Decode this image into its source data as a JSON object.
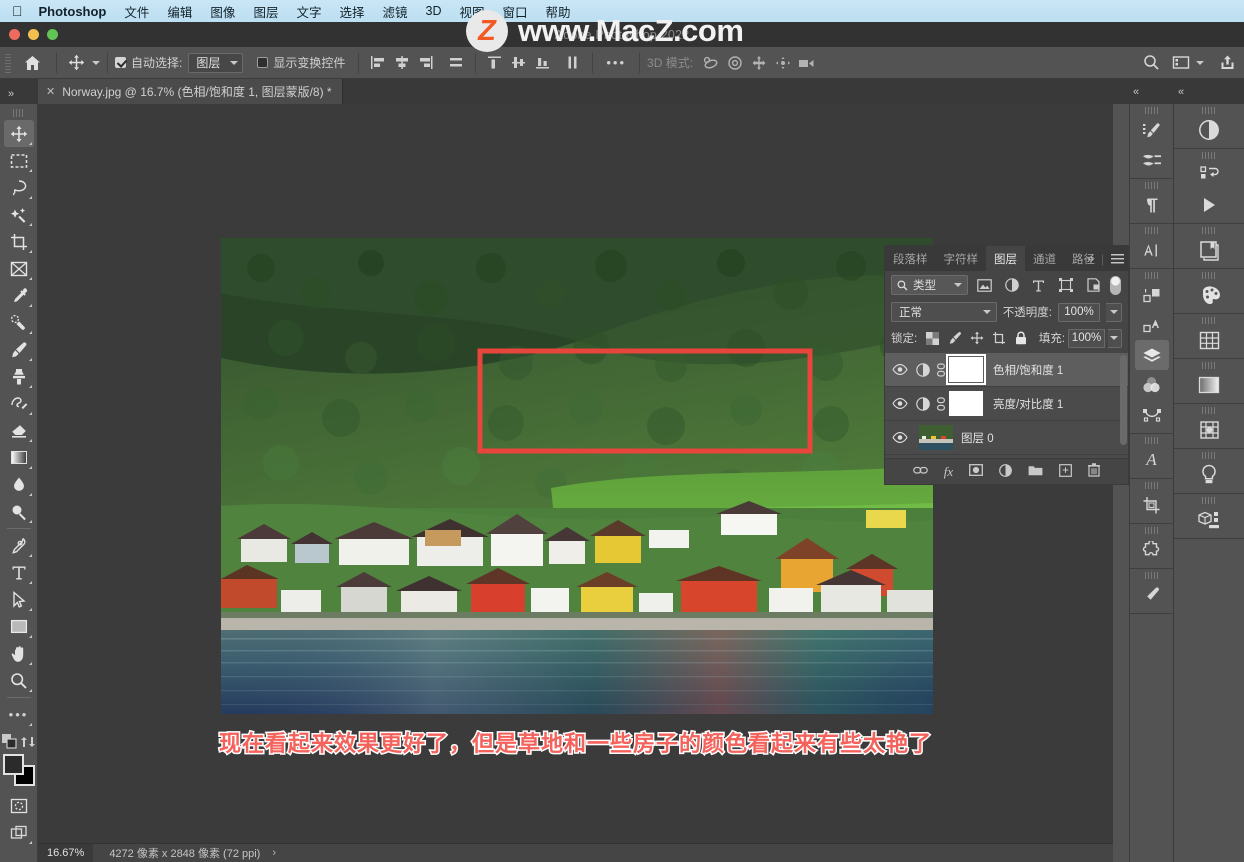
{
  "menubar": {
    "apple_icon": "apple-icon",
    "app_name": "Photoshop",
    "items": [
      "文件",
      "编辑",
      "图像",
      "图层",
      "文字",
      "选择",
      "滤镜",
      "3D",
      "视图",
      "窗口",
      "帮助"
    ]
  },
  "titlebar": {
    "title": "Adobe Photoshop 2022"
  },
  "watermark": {
    "text": "www.MacZ.com",
    "logo_letter": "Z"
  },
  "options_bar": {
    "home_icon": "home-icon",
    "tool_icon": "move-tool-icon",
    "auto_select_checked": true,
    "auto_select_label": "自动选择:",
    "auto_select_value": "图层",
    "show_transform_checked": false,
    "show_transform_label": "显示变换控件",
    "align_icons": [
      "align-left-edges-icon",
      "align-horizontal-centers-icon",
      "align-right-edges-icon",
      "distribute-horizontally-icon"
    ],
    "align_icons2": [
      "align-top-edges-icon",
      "align-vertical-centers-icon",
      "align-bottom-edges-icon",
      "distribute-vertically-icon"
    ],
    "more_label": "•••",
    "mode3d_label": "3D 模式:",
    "mode3d_icons": [
      "orbit-3d-icon",
      "roll-3d-icon",
      "pan-3d-icon",
      "slide-3d-icon",
      "camera-3d-icon"
    ],
    "search_icon": "search-icon",
    "workspace_icon": "workspace-icon",
    "share_icon": "share-icon"
  },
  "document_tab": {
    "close_icon": "close-icon",
    "title": "Norway.jpg @ 16.7% (色相/饱和度 1, 图层蒙版/8) *"
  },
  "toolbar": {
    "tools": [
      {
        "name": "move-tool",
        "active": true
      },
      {
        "name": "rectangular-marquee-tool",
        "active": false
      },
      {
        "name": "lasso-tool",
        "active": false
      },
      {
        "name": "object-selection-tool",
        "active": false
      },
      {
        "name": "crop-tool",
        "active": false
      },
      {
        "name": "frame-tool",
        "active": false
      },
      {
        "name": "eyedropper-tool",
        "active": false
      },
      {
        "name": "spot-healing-brush-tool",
        "active": false
      },
      {
        "name": "brush-tool",
        "active": false
      },
      {
        "name": "clone-stamp-tool",
        "active": false
      },
      {
        "name": "history-brush-tool",
        "active": false
      },
      {
        "name": "eraser-tool",
        "active": false
      },
      {
        "name": "gradient-tool",
        "active": false
      },
      {
        "name": "blur-tool",
        "active": false
      },
      {
        "name": "dodge-tool",
        "active": false
      },
      {
        "name": "pen-tool",
        "active": false
      },
      {
        "name": "type-tool",
        "active": false
      },
      {
        "name": "path-selection-tool",
        "active": false
      },
      {
        "name": "rectangle-tool",
        "active": false
      },
      {
        "name": "hand-tool",
        "active": false
      },
      {
        "name": "zoom-tool",
        "active": false
      },
      {
        "name": "edit-toolbar-tool",
        "active": false
      }
    ],
    "default_colors_icon": "default-colors-icon",
    "swap-colors-icon": "swap-colors-icon",
    "foreground_color": "#2b2b2b",
    "background_color": "#000000",
    "quickmask_icon": "quick-mask-icon",
    "screenmode_icon": "screen-mode-icon"
  },
  "canvas": {
    "caption_text": "现在看起来效果更好了，但是草地和一些房子的颜色看起来有些太艳了",
    "caption_color": "#f4625c",
    "selection_rect_color": "#e8453c",
    "image_title": "Norway.jpg"
  },
  "status_bar": {
    "zoom": "16.67%",
    "doc_info": "4272 像素 x 2848 像素 (72 ppi)",
    "arrow": "›"
  },
  "layers_panel": {
    "tabs": [
      {
        "label": "段落样",
        "active": false
      },
      {
        "label": "字符样",
        "active": false
      },
      {
        "label": "图层",
        "active": true
      },
      {
        "label": "通道",
        "active": false
      },
      {
        "label": "路径",
        "active": false
      }
    ],
    "overflow_label": "»",
    "menu_icon": "panel-menu-icon",
    "filter": {
      "search_icon": "search-icon",
      "type_label": "类型",
      "icons": [
        "pixel-filter-icon",
        "adjustment-filter-icon",
        "type-filter-icon",
        "shape-filter-icon",
        "smartobject-filter-icon"
      ],
      "toggle_icon": "filter-toggle-icon"
    },
    "blend_mode": "正常",
    "opacity_label": "不透明度:",
    "opacity_value": "100%",
    "lock_label": "锁定:",
    "lock_icons": [
      "lock-transparent-pixels-icon",
      "lock-image-pixels-icon",
      "lock-position-icon",
      "lock-artboard-icon",
      "lock-all-icon"
    ],
    "fill_label": "填充:",
    "fill_value": "100%",
    "layers": [
      {
        "name": "色相/饱和度 1",
        "visible": true,
        "selected": true,
        "kind": "adjustment",
        "mask_selected": true
      },
      {
        "name": "亮度/对比度 1",
        "visible": true,
        "selected": false,
        "kind": "adjustment",
        "mask_selected": false
      },
      {
        "name": "图层 0",
        "visible": true,
        "selected": false,
        "kind": "image",
        "mask_selected": false
      }
    ],
    "footer_icons": [
      "link-layers-icon",
      "layer-style-icon",
      "layer-mask-icon",
      "new-adjustment-layer-icon",
      "new-group-icon",
      "new-layer-icon",
      "delete-layer-icon"
    ]
  },
  "right_rail_inner": {
    "groups": [
      [
        "brushes-icon",
        "brush-settings-icon"
      ],
      [
        "paragraph-icon"
      ],
      [
        "character-icon"
      ],
      [
        "layers-comp-icon",
        "glyphs-icon",
        "layers-panel-icon",
        "channels-icon",
        "paths-icon"
      ],
      [
        "styles-icon"
      ],
      [
        "crop-properties-icon"
      ],
      [
        "puzzle-icon"
      ],
      [
        "brush-preset-icon"
      ]
    ]
  },
  "right_rail_outer": {
    "groups": [
      [
        "adjustments-icon"
      ],
      [
        "actions-icon",
        "play-icon"
      ],
      [
        "history-icon"
      ],
      [
        "swatches-icon"
      ],
      [
        "patterns-icon"
      ],
      [
        "gradients-icon"
      ],
      [
        "shapes-icon"
      ],
      [
        "learn-icon"
      ],
      [
        "3d-icon"
      ]
    ]
  }
}
